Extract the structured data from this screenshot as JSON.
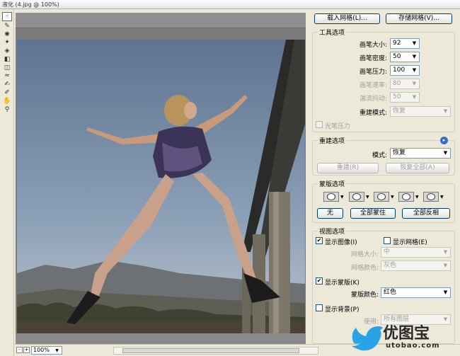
{
  "window": {
    "title": "液化 (4.jpg @ 100%)"
  },
  "toolbox": {
    "tools": [
      "forward-warp",
      "reconstruct",
      "twirl",
      "pucker",
      "bloat",
      "push-left",
      "mirror",
      "turbulence",
      "freeze-mask",
      "thaw-mask",
      "hand",
      "zoom"
    ]
  },
  "statusbar": {
    "zoom_value": "100%",
    "minus_label": "-",
    "plus_label": "+"
  },
  "panel": {
    "load_mesh_label": "载入网格(L)...",
    "save_mesh_label": "存储网格(V)...",
    "tool_options": {
      "title": "工具选项",
      "brush_size_label": "画笔大小:",
      "brush_size_value": "92",
      "brush_density_label": "画笔密度:",
      "brush_density_value": "50",
      "brush_pressure_label": "画笔压力:",
      "brush_pressure_value": "100",
      "brush_rate_label": "画笔速率:",
      "brush_rate_value": "80",
      "turbulent_jitter_label": "湍流抖动:",
      "turbulent_jitter_value": "50",
      "reconstruct_mode_label": "重建模式:",
      "reconstruct_mode_value": "恢复",
      "stylus_pressure_label": "光笔压力"
    },
    "reconstruct_options": {
      "title": "重建选项",
      "mode_label": "模式:",
      "mode_value": "恢复",
      "reconstruct_button": "重建(R)",
      "restore_all_button": "恢复全部(A)"
    },
    "mask_options": {
      "title": "蒙版选项",
      "none_button": "无",
      "mask_all_button": "全部蒙住",
      "invert_all_button": "全部反相"
    },
    "view_options": {
      "title": "视图选项",
      "show_image_label": "显示图像(I)",
      "show_image_checked": true,
      "show_mesh_label": "显示网格(E)",
      "show_mesh_checked": false,
      "mesh_size_label": "网格大小:",
      "mesh_size_value": "中",
      "mesh_color_label": "网格颜色:",
      "mesh_color_value": "灰色",
      "show_mask_label": "显示蒙版(K)",
      "show_mask_checked": true,
      "mask_color_label": "蒙版颜色:",
      "mask_color_value": "红色",
      "show_backdrop_label": "显示背景(P)",
      "show_backdrop_checked": false,
      "use_label": "使用:",
      "use_value": "所有图层"
    }
  },
  "watermark": {
    "brand": "优图宝",
    "domain": "utobao.com"
  }
}
